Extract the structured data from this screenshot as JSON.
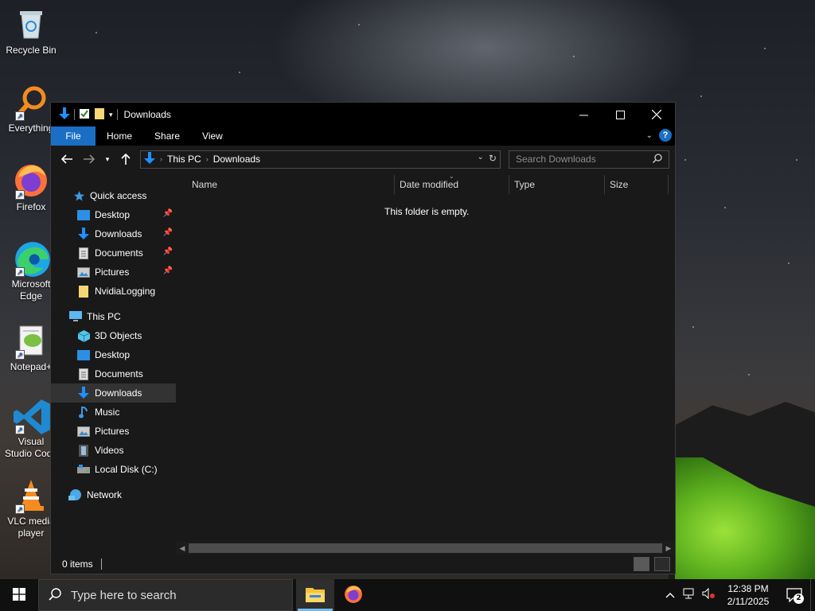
{
  "desktop": {
    "icons": [
      {
        "label": "Recycle Bin"
      },
      {
        "label": "Everything"
      },
      {
        "label": "Firefox"
      },
      {
        "label": "Microsoft Edge"
      },
      {
        "label": "Notepad+"
      },
      {
        "label": "Visual Studio Code"
      },
      {
        "label": "VLC media player"
      }
    ]
  },
  "window": {
    "title": "Downloads",
    "ribbon_tabs": [
      "File",
      "Home",
      "Share",
      "View"
    ],
    "breadcrumb": [
      "This PC",
      "Downloads"
    ],
    "search_placeholder": "Search Downloads",
    "nav": {
      "quick_access": "Quick access",
      "quick_items": [
        "Desktop",
        "Downloads",
        "Documents",
        "Pictures",
        "NvidiaLogging"
      ],
      "this_pc": "This PC",
      "pc_items": [
        "3D Objects",
        "Desktop",
        "Documents",
        "Downloads",
        "Music",
        "Pictures",
        "Videos",
        "Local Disk (C:)"
      ],
      "network": "Network",
      "selected": "Downloads"
    },
    "columns": [
      "Name",
      "Date modified",
      "Type",
      "Size"
    ],
    "empty_message": "This folder is empty.",
    "status": "0 items"
  },
  "taskbar": {
    "search_placeholder": "Type here to search",
    "time": "12:38 PM",
    "date": "2/11/2025",
    "notification_count": "2"
  },
  "colors": {
    "accent": "#1a6fc4",
    "window_bg": "#191919",
    "taskbar_bg": "#101010"
  }
}
